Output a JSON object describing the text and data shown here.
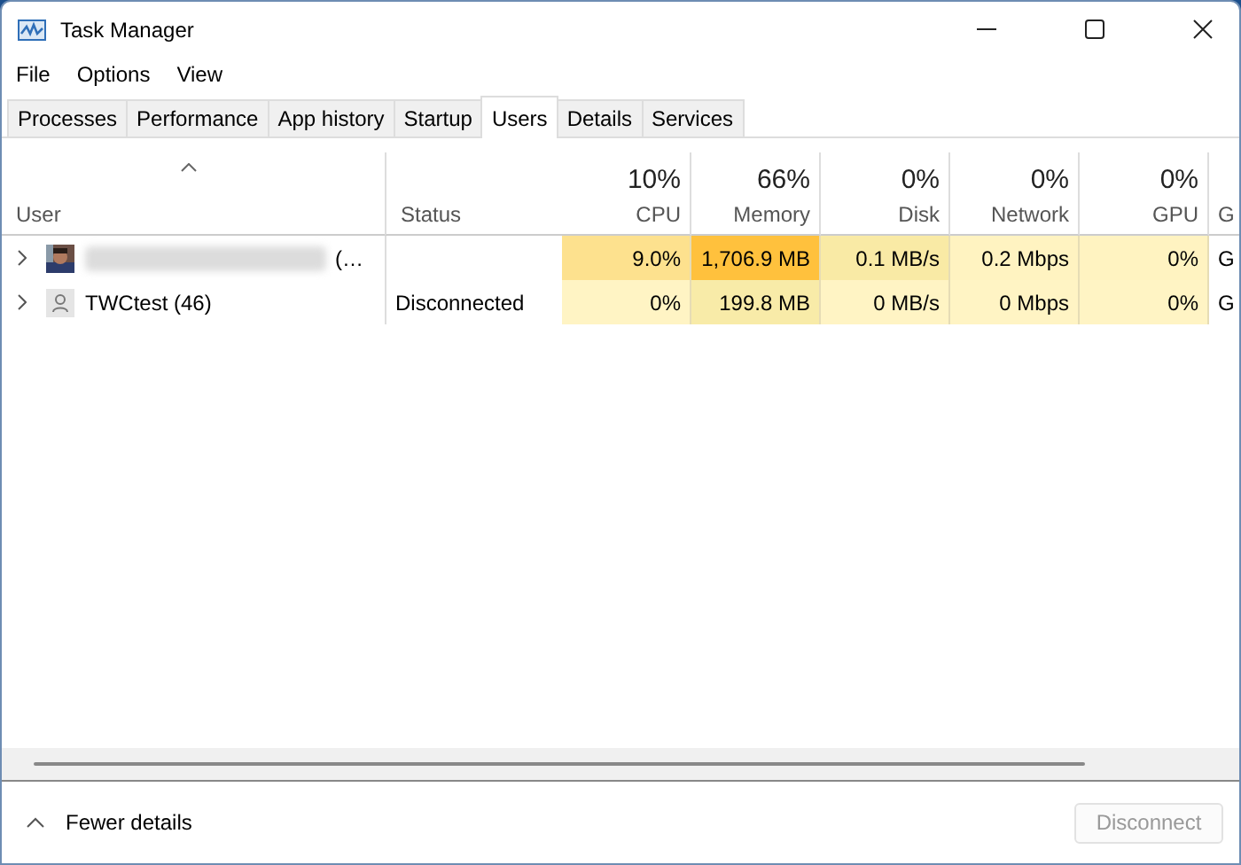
{
  "window": {
    "title": "Task Manager"
  },
  "menu": [
    "File",
    "Options",
    "View"
  ],
  "tabs": [
    {
      "label": "Processes",
      "selected": false
    },
    {
      "label": "Performance",
      "selected": false
    },
    {
      "label": "App history",
      "selected": false
    },
    {
      "label": "Startup",
      "selected": false
    },
    {
      "label": "Users",
      "selected": true
    },
    {
      "label": "Details",
      "selected": false
    },
    {
      "label": "Services",
      "selected": false
    }
  ],
  "table": {
    "columns": [
      {
        "label": "User"
      },
      {
        "label": "Status"
      },
      {
        "label": "CPU",
        "total": "10%"
      },
      {
        "label": "Memory",
        "total": "66%"
      },
      {
        "label": "Disk",
        "total": "0%"
      },
      {
        "label": "Network",
        "total": "0%"
      },
      {
        "label": "GPU",
        "total": "0%"
      },
      {
        "label": "G"
      }
    ],
    "rows": [
      {
        "redacted": true,
        "cells": [
          {
            "text": "(…"
          },
          {
            "text": ""
          },
          {
            "text": "9.0%",
            "color": "#fde18e"
          },
          {
            "text": "1,706.9 MB",
            "color": "#ffc13d"
          },
          {
            "text": "0.1 MB/s",
            "color": "#f9eaa5"
          },
          {
            "text": "0.2 Mbps",
            "color": "#fff3c1"
          },
          {
            "text": "0%",
            "color": "#fff3c1"
          },
          {
            "text": "G",
            "color": "#ffffff"
          }
        ]
      },
      {
        "kind": "generic",
        "redacted": false,
        "cells": [
          {
            "text": "TWCtest (46)"
          },
          {
            "text": "Disconnected"
          },
          {
            "text": "0%",
            "color": "#fff4c4"
          },
          {
            "text": "199.8 MB",
            "color": "#f8eba8"
          },
          {
            "text": "0 MB/s",
            "color": "#fff4c4"
          },
          {
            "text": "0 Mbps",
            "color": "#fff4c4"
          },
          {
            "text": "0%",
            "color": "#fff4c4"
          },
          {
            "text": "G",
            "color": "#ffffff"
          }
        ]
      }
    ]
  },
  "footer": {
    "toggle": "Fewer details",
    "button": {
      "label": "Disconnect",
      "disabled": true
    }
  }
}
